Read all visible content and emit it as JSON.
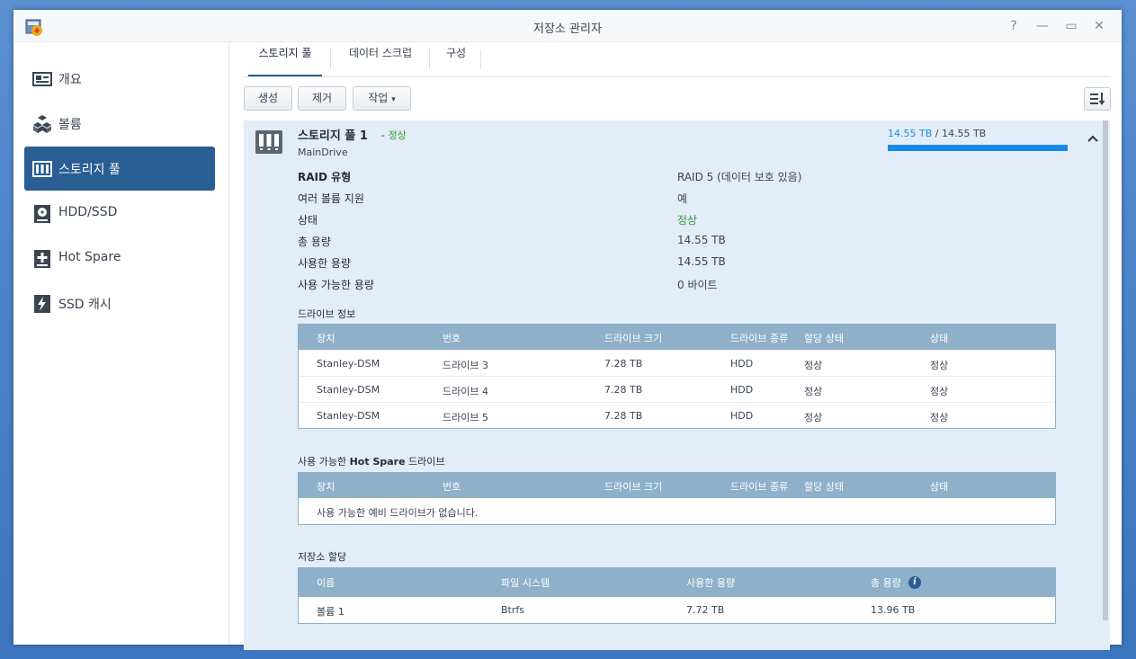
{
  "window": {
    "title": "저장소 관리자",
    "controls": {
      "help": "?",
      "minimize": "—",
      "maximize": "▭",
      "close": "✕"
    }
  },
  "sidebar": {
    "items": [
      {
        "label": "개요",
        "icon": "overview-icon"
      },
      {
        "label": "볼륨",
        "icon": "volume-cubes-icon"
      },
      {
        "label": "스토리지 풀",
        "icon": "storage-pool-icon",
        "active": true
      },
      {
        "label": "HDD/SSD",
        "icon": "hdd-icon"
      },
      {
        "label": "Hot Spare",
        "icon": "hot-spare-icon"
      },
      {
        "label": "SSD 캐시",
        "icon": "ssd-cache-icon"
      }
    ]
  },
  "tabs": [
    "스토리지 풀",
    "데이터 스크럽",
    "구성"
  ],
  "toolbar": {
    "create": "생성",
    "remove": "제거",
    "action": "작업",
    "action_caret": "▾"
  },
  "pool": {
    "name": "스토리지 풀 1",
    "separator": " - ",
    "status": "정상",
    "description": "MainDrive",
    "capacity_used": "14.55 TB",
    "capacity_sep": " / ",
    "capacity_total": "14.55 TB",
    "usage_fraction": 1.0,
    "collapse_glyph": "⌃",
    "details": [
      {
        "key": "RAID 유형",
        "value": "RAID 5 (데이터 보호 있음)"
      },
      {
        "key": "여러 볼륨 지원",
        "value": "예"
      },
      {
        "key": "상태",
        "value": "정상",
        "status": true
      },
      {
        "key": "총 용량",
        "value": "14.55 TB"
      },
      {
        "key": "사용한 용량",
        "value": "14.55 TB"
      },
      {
        "key": "사용 가능한 용량",
        "value": "0 바이트"
      }
    ]
  },
  "drive_info": {
    "title": "드라이브 정보",
    "headers": [
      "장치",
      "번호",
      "드라이브 크기",
      "드라이브 종류",
      "할당 상태",
      "상태"
    ],
    "rows": [
      [
        "Stanley-DSM",
        "드라이브 3",
        "7.28 TB",
        "HDD",
        "정상",
        "정상"
      ],
      [
        "Stanley-DSM",
        "드라이브 4",
        "7.28 TB",
        "HDD",
        "정상",
        "정상"
      ],
      [
        "Stanley-DSM",
        "드라이브 5",
        "7.28 TB",
        "HDD",
        "정상",
        "정상"
      ]
    ]
  },
  "hot_spare": {
    "title_prefix": "사용 가능한 ",
    "title_bold": "Hot Spare",
    "title_suffix": " 드라이브",
    "headers": [
      "장치",
      "번호",
      "드라이브 크기",
      "드라이브 종류",
      "할당 상태",
      "상태"
    ],
    "empty_message": "사용 가능한 예비 드라이브가 없습니다."
  },
  "allocation": {
    "title": "저장소 할당",
    "headers": [
      "이름",
      "파일 시스템",
      "사용한 용량",
      "총 용량"
    ],
    "info_glyph": "i",
    "rows": [
      [
        "볼륨 1",
        "Btrfs",
        "7.72 TB",
        "13.96 TB"
      ]
    ]
  },
  "colors": {
    "accent": "#2a5d93",
    "status_ok": "#2f9a2f",
    "capacity_bar": "#1689e8",
    "table_header": "#8fb0c9",
    "panel_bg": "#e3edf8"
  }
}
